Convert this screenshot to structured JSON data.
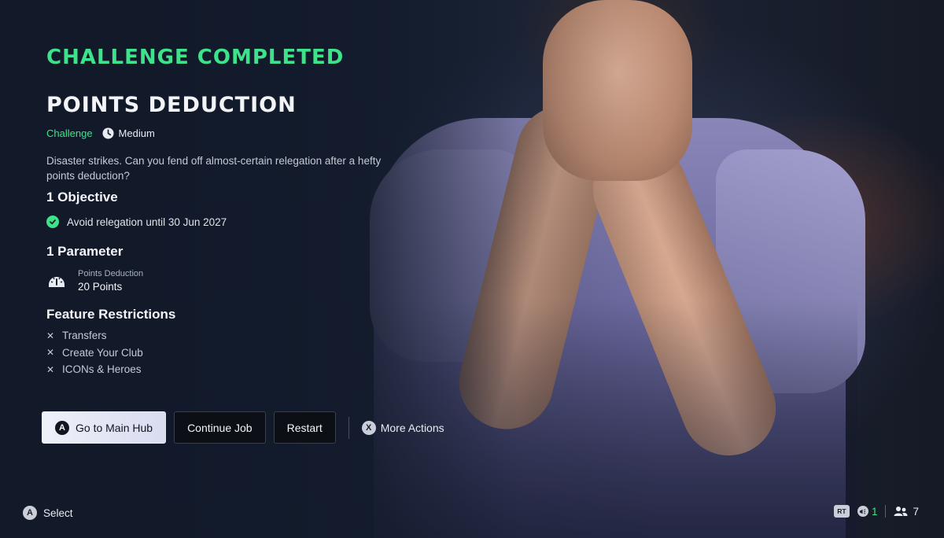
{
  "header": {
    "kicker": "CHALLENGE COMPLETED",
    "title": "POINTS DEDUCTION"
  },
  "meta": {
    "type": "Challenge",
    "difficulty": "Medium",
    "difficulty_icon": "clock-icon"
  },
  "description": "Disaster strikes. Can you fend off almost-certain relegation after a hefty points deduction?",
  "objectives": {
    "heading": "1 Objective",
    "items": [
      {
        "text": "Avoid relegation until 30 Jun 2027",
        "status_icon": "check-circle-icon"
      }
    ]
  },
  "parameters": {
    "heading": "1 Parameter",
    "items": [
      {
        "label": "Points Deduction",
        "value": "20 Points",
        "icon": "gauge-icon"
      }
    ]
  },
  "restrictions": {
    "heading": "Feature Restrictions",
    "items": [
      "Transfers",
      "Create Your Club",
      "ICONs & Heroes"
    ]
  },
  "actions": {
    "primary": {
      "glyph": "A",
      "label": "Go to Main Hub"
    },
    "continue_label": "Continue Job",
    "restart_label": "Restart",
    "more": {
      "glyph": "X",
      "label": "More Actions"
    }
  },
  "footer": {
    "select_glyph": "A",
    "select_label": "Select",
    "rt_label": "RT",
    "notification_count": "1",
    "friends_count": "7"
  },
  "colors": {
    "accent_green": "#3ee28a",
    "background": "#172235"
  }
}
